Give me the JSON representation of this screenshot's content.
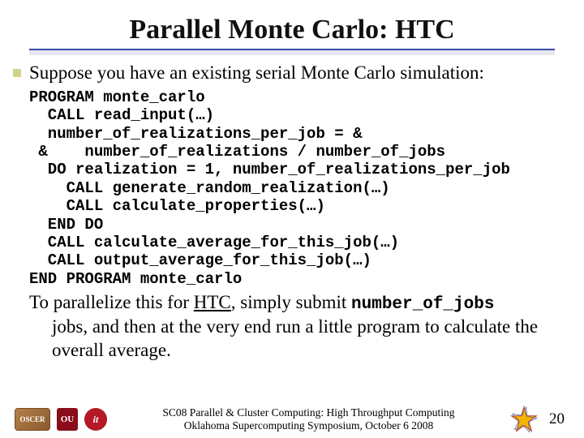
{
  "title": "Parallel Monte Carlo: HTC",
  "intro": "Suppose you have an existing serial Monte Carlo simulation:",
  "code": "PROGRAM monte_carlo\n  CALL read_input(…)\n  number_of_realizations_per_job = &\n &    number_of_realizations / number_of_jobs\n  DO realization = 1, number_of_realizations_per_job\n    CALL generate_random_realization(…)\n    CALL calculate_properties(…)\n  END DO\n  CALL calculate_average_for_this_job(…)\n  CALL output_average_for_this_job(…)\nEND PROGRAM monte_carlo",
  "outro_pre": "To parallelize this for ",
  "outro_htc": "HTC",
  "outro_mid": ", simply submit ",
  "outro_mono": "number_of_jobs",
  "outro_tail": " jobs, and then at the very end run a little program to calculate the overall average.",
  "footer": {
    "line1": "SC08 Parallel & Cluster Computing: High Throughput Computing",
    "line2": "Oklahoma Supercomputing Symposium, October 6 2008",
    "page": "20",
    "oscer": "OSCER",
    "ou": "OU",
    "it": "it"
  }
}
